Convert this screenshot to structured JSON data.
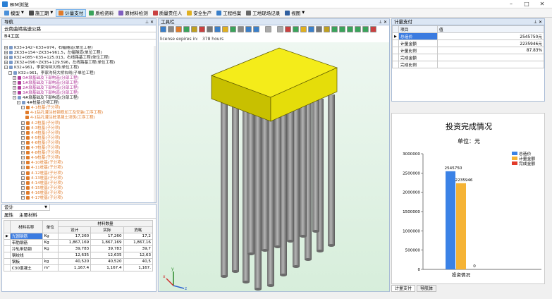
{
  "window": {
    "title": "BIM浏览",
    "minimize": "–",
    "maximize": "□",
    "close": "✕"
  },
  "menu": [
    {
      "label": "模型",
      "color": "#4a90d9",
      "active": false
    },
    {
      "label": "施工期",
      "color": "#4a4a4a",
      "active": false
    },
    {
      "label": "计量支付",
      "color": "#e07b2a",
      "active": true
    },
    {
      "label": "质检资料",
      "color": "#3aa35b",
      "active": false
    },
    {
      "label": "原材料检测",
      "color": "#7f5fbf",
      "active": false
    },
    {
      "label": "质量责任人",
      "color": "#c94040",
      "active": false
    },
    {
      "label": "安全生产",
      "color": "#e0b020",
      "active": false
    },
    {
      "label": "工程档案",
      "color": "#3a7fc9",
      "active": false
    },
    {
      "label": "工地现场记录",
      "color": "#666666",
      "active": false
    },
    {
      "label": "视图",
      "color": "#2f5fa0",
      "active": false
    }
  ],
  "nav": {
    "title": "导航",
    "pin": "⊥ ✕",
    "project": "云南曲靖高速公路",
    "section": "B4工区",
    "tree": [
      {
        "label": "K33+142~K33+974，右幅隧道(单位工程)",
        "indent": 0,
        "exp": "+",
        "color": "#222"
      },
      {
        "label": "ZK33+154~ZK33+961.5，左幅隧道(单位工程)",
        "indent": 0,
        "exp": "+",
        "color": "#222"
      },
      {
        "label": "K32+085~K35+125.013，右线路基工程(单位工程)",
        "indent": 0,
        "exp": "+",
        "color": "#222"
      },
      {
        "label": "ZK32+096~ZK35+129.596，左线路基工程(单位工程)",
        "indent": 0,
        "exp": "+",
        "color": "#222"
      },
      {
        "label": "K32+961，李家沟特大桥(单位工程)",
        "indent": 0,
        "exp": "–",
        "color": "#222"
      },
      {
        "label": "K32+961，李家沟特大桥右线(子单位工程)",
        "indent": 1,
        "exp": "–",
        "color": "#222"
      },
      {
        "label": "0#墩基础及下部构造(分部工程)",
        "indent": 2,
        "exp": "+",
        "color": "#b03a9a"
      },
      {
        "label": "1#墩基础及下部构造(分部工程)",
        "indent": 2,
        "exp": "+",
        "color": "#b03a9a"
      },
      {
        "label": "2#墩基础及下部构造(分部工程)",
        "indent": 2,
        "exp": "+",
        "color": "#b03a9a"
      },
      {
        "label": "3#墩基础及下部构造(分部工程)",
        "indent": 2,
        "exp": "+",
        "color": "#b03a9a"
      },
      {
        "label": "4#墩基础及下部构造(分部工程)",
        "indent": 2,
        "exp": "–",
        "color": "#222"
      },
      {
        "label": "4#桩基(分项工程)",
        "indent": 3,
        "exp": "–",
        "color": "#222"
      },
      {
        "label": "4-1桩基(子分项)",
        "indent": 4,
        "exp": "–",
        "color": "#e07b2a"
      },
      {
        "label": "4-1钻孔灌注桩钢筋加工及安装(工序工程)",
        "indent": 5,
        "exp": "",
        "color": "#e07b2a"
      },
      {
        "label": "4-1钻孔灌注桩混凝土浇筑(工序工程)",
        "indent": 5,
        "exp": "",
        "color": "#e07b2a"
      },
      {
        "label": "4-2桩基(子分项)",
        "indent": 4,
        "exp": "+",
        "color": "#e07b2a"
      },
      {
        "label": "4-3桩基(子分项)",
        "indent": 4,
        "exp": "+",
        "color": "#e07b2a"
      },
      {
        "label": "4-4桩基(子分项)",
        "indent": 4,
        "exp": "+",
        "color": "#e07b2a"
      },
      {
        "label": "4-5桩基(子分项)",
        "indent": 4,
        "exp": "+",
        "color": "#e07b2a"
      },
      {
        "label": "4-6桩基(子分项)",
        "indent": 4,
        "exp": "+",
        "color": "#e07b2a"
      },
      {
        "label": "4-7桩基(子分项)",
        "indent": 4,
        "exp": "+",
        "color": "#e07b2a"
      },
      {
        "label": "4-8桩基(子分项)",
        "indent": 4,
        "exp": "+",
        "color": "#e07b2a"
      },
      {
        "label": "4-9桩基(子分项)",
        "indent": 4,
        "exp": "+",
        "color": "#e07b2a"
      },
      {
        "label": "4-10桩基(子分项)",
        "indent": 4,
        "exp": "+",
        "color": "#e07b2a"
      },
      {
        "label": "4-11桩基(子分项)",
        "indent": 4,
        "exp": "+",
        "color": "#e07b2a"
      },
      {
        "label": "4-12桩基(子分项)",
        "indent": 4,
        "exp": "+",
        "color": "#e07b2a"
      },
      {
        "label": "4-13桩基(子分项)",
        "indent": 4,
        "exp": "+",
        "color": "#e07b2a"
      },
      {
        "label": "4-14桩基(子分项)",
        "indent": 4,
        "exp": "+",
        "color": "#e07b2a"
      },
      {
        "label": "4-15桩基(子分项)",
        "indent": 4,
        "exp": "+",
        "color": "#e07b2a"
      },
      {
        "label": "4-16桩基(子分项)",
        "indent": 4,
        "exp": "+",
        "color": "#e07b2a"
      },
      {
        "label": "4-17桩基(子分项)",
        "indent": 4,
        "exp": "+",
        "color": "#e07b2a"
      }
    ]
  },
  "props": {
    "dropdown": "设计",
    "tab_attr": "属性",
    "tab_material": "主要材料",
    "headers": {
      "name": "材料名称",
      "unit": "单位",
      "qty": "材料数量",
      "design": "设计",
      "actual": "实际",
      "consume": "消耗"
    },
    "rows": [
      {
        "name": "光圆钢筋",
        "unit": "Kg",
        "design": "17,260",
        "actual": "17,260",
        "consume": "17,2"
      },
      {
        "name": "带肋钢筋",
        "unit": "Kg",
        "design": "1,867,169",
        "actual": "1,867,169",
        "consume": "1,867,16"
      },
      {
        "name": "冷轧带肋钢",
        "unit": "Kg",
        "design": "39,783",
        "actual": "39,783",
        "consume": "39,7"
      },
      {
        "name": "钢绞线",
        "unit": "",
        "design": "12,635",
        "actual": "12,635",
        "consume": "12,63"
      },
      {
        "name": "钢板",
        "unit": "kg",
        "design": "40,520",
        "actual": "40,520",
        "consume": "40,5"
      },
      {
        "name": "C30混凝土",
        "unit": "m³",
        "design": "1,167.4",
        "actual": "1,167.4",
        "consume": "1,167."
      }
    ]
  },
  "toolbox": {
    "title": "工具栏",
    "pin": "⊥ ✕",
    "license_label": "license expires in:",
    "license_value": "378 hours",
    "tool_colors": [
      "#3a7fc9",
      "#888",
      "#e07b2a",
      "#3aa35b",
      "#bfa020",
      "#c94040",
      "#777",
      "#3a7fc9",
      "#e0b020",
      "#3aa35b",
      "#888",
      "#3a7fc9",
      "#3a7fc9",
      "#aaa",
      "#aaa",
      "#c94040",
      "#3aa35b",
      "#e0b020",
      "#3a7fc9",
      "#777",
      "#bfa020",
      "#3aa35b",
      "#3aa35b",
      "#3aa35b",
      "#3aa35b",
      "#3aa35b",
      "#c94040"
    ],
    "axis_x": "x",
    "axis_y": "y",
    "axis_z": "z"
  },
  "payment": {
    "title": "计量支付",
    "pin": "⊥ ✕",
    "col_item": "项目",
    "col_value": "值",
    "rows": [
      {
        "item": "总造价",
        "value": "2545750元"
      },
      {
        "item": "计量金额",
        "value": "2235946元"
      },
      {
        "item": "计量比例",
        "value": "87.83%"
      },
      {
        "item": "完成金额",
        "value": ""
      },
      {
        "item": "完成比例",
        "value": ""
      }
    ]
  },
  "chart_data": {
    "type": "bar",
    "title": "投资完成情况",
    "subtitle": "单位：元",
    "categories": [
      "投资情况"
    ],
    "series": [
      {
        "name": "总造价",
        "values": [
          2545750
        ],
        "color": "#3b82e6",
        "label": "2545750"
      },
      {
        "name": "计量金额",
        "values": [
          2235946
        ],
        "color": "#f5b335",
        "label": "2235946"
      },
      {
        "name": "完成金额",
        "values": [
          0
        ],
        "color": "#e23b2a",
        "label": "0"
      }
    ],
    "ylim": [
      0,
      3000000
    ],
    "yticks": [
      0,
      500000,
      1000000,
      1500000,
      2000000,
      2500000,
      3000000
    ],
    "ytick_labels": [
      "0",
      "500000",
      "1000000",
      "1500000",
      "2000000",
      "2500000",
      "3000000"
    ],
    "legend": "top-right",
    "grid": false
  },
  "bottom_tabs": [
    "计量支付",
    "导航体"
  ]
}
